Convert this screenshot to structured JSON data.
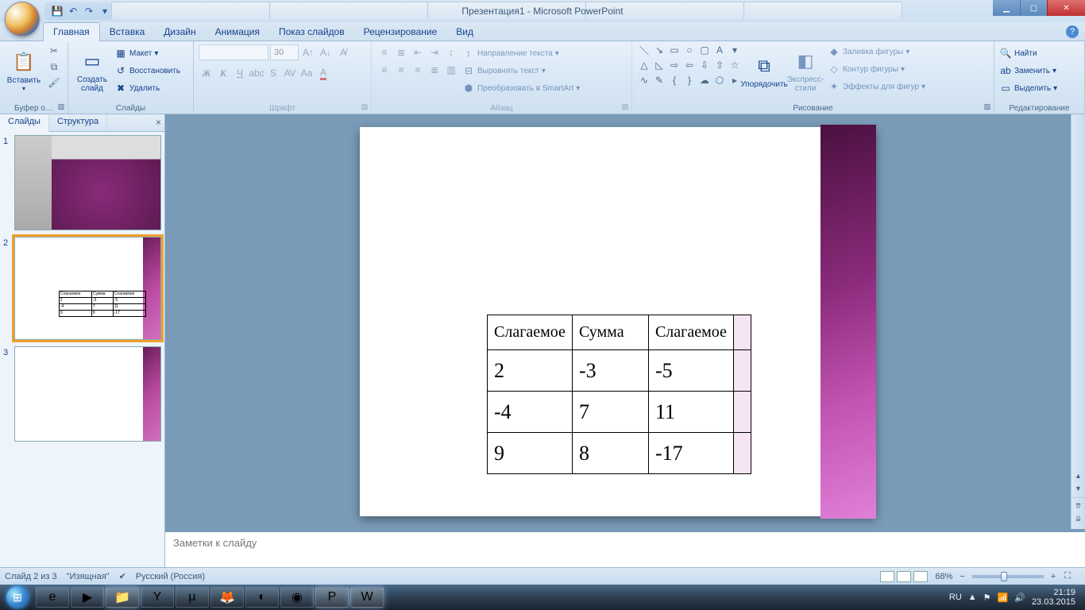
{
  "title": "Презентация1 - Microsoft PowerPoint",
  "qat": {
    "save": "💾",
    "undo": "↶",
    "redo": "↷"
  },
  "bgtabs": [
    "",
    "",
    "",
    "",
    "",
    ""
  ],
  "ribbon_tabs": [
    "Главная",
    "Вставка",
    "Дизайн",
    "Анимация",
    "Показ слайдов",
    "Рецензирование",
    "Вид"
  ],
  "ribbon_active": 0,
  "groups": {
    "clipboard": {
      "label": "Буфер о…",
      "paste": "Вставить"
    },
    "slides": {
      "label": "Слайды",
      "new": "Создать\nслайд",
      "layout": "Макет",
      "reset": "Восстановить",
      "delete": "Удалить"
    },
    "font": {
      "label": "Шрифт",
      "name": "",
      "size": "30"
    },
    "paragraph": {
      "label": "Абзац",
      "textdir": "Направление текста",
      "align": "Выровнять текст",
      "smartart": "Преобразовать в SmartArt"
    },
    "drawing": {
      "label": "Рисование",
      "arrange": "Упорядочить",
      "quick": "Экспресс-стили",
      "fill": "Заливка фигуры",
      "outline": "Контур фигуры",
      "effects": "Эффекты для фигур"
    },
    "editing": {
      "label": "Редактирование",
      "find": "Найти",
      "replace": "Заменить",
      "select": "Выделить"
    }
  },
  "slide_panel": {
    "tabs": [
      "Слайды",
      "Структура"
    ],
    "active": 0,
    "count": 3,
    "selected": 2
  },
  "table": {
    "headers": [
      "Слагаемое",
      "Сумма",
      "Слагаемое"
    ],
    "rows": [
      [
        "2",
        "-3",
        "-5"
      ],
      [
        "-4",
        "7",
        "11"
      ],
      [
        "9",
        "8",
        "-17"
      ]
    ]
  },
  "notes_placeholder": "Заметки к слайду",
  "status": {
    "slide": "Слайд 2 из 3",
    "theme": "\"Изящная\"",
    "lang": "Русский (Россия)",
    "zoom": "68%"
  },
  "tray": {
    "lang": "RU",
    "time": "21:19",
    "date": "23.03.2015"
  }
}
